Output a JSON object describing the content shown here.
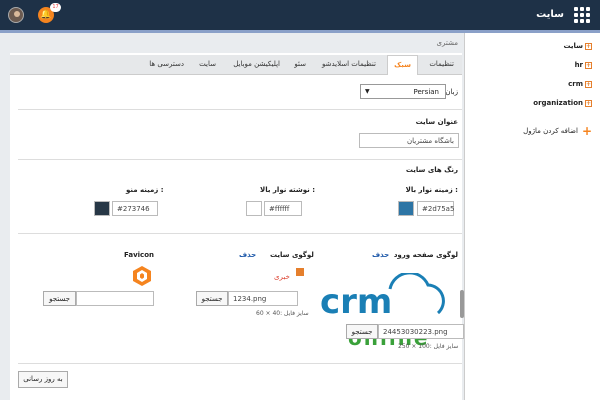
{
  "topbar": {
    "title": "سایت",
    "notification_count": "17",
    "avatar_icon": "user-avatar",
    "bell_icon": "bell-icon",
    "apps_icon": "grid-icon"
  },
  "sidebar": {
    "items": [
      {
        "label": "سایت"
      },
      {
        "label": "hr"
      },
      {
        "label": "crm"
      },
      {
        "label": "organization"
      }
    ],
    "add_module": "اضافه کردن ماژول"
  },
  "breadcrumb": "مشتری",
  "tabs": [
    {
      "label": "تنظیمات"
    },
    {
      "label": "سبک",
      "active": true
    },
    {
      "label": "تنظیمات اسلایدشو"
    },
    {
      "label": "سئو"
    },
    {
      "label": "اپلیکیشن موبایل"
    },
    {
      "label": "سایت"
    },
    {
      "label": "دسترسی ها"
    }
  ],
  "language": {
    "label": "زبان",
    "value": "Persian"
  },
  "site_title": {
    "heading": "عنوان سایت",
    "value": "باشگاه مشتریان"
  },
  "colors": {
    "heading": "رنگ های سایت",
    "topbar_bg": {
      "label": "زمینه نوار بالا :",
      "value": "#2d75a5"
    },
    "topbar_text": {
      "label": "نوشته نوار بالا :",
      "value": "#ffffff"
    },
    "menu_bg": {
      "label": "زمینه منو :",
      "value": "#273746"
    }
  },
  "logos": {
    "login_logo": {
      "label": "لوگوی صفحه ورود",
      "delete": "حذف",
      "file": "24453030223.png",
      "browse": "جستجو",
      "size_hint": "سایز فایل :100 × 250",
      "logo_text_top": "crm",
      "logo_text_bottom": "online"
    },
    "site_logo": {
      "label": "لوگوی سایت",
      "delete": "حذف",
      "file": "1234.png",
      "browse": "جستجو",
      "size_hint": "سایز فایل :40 × 60"
    },
    "favicon": {
      "label": "Favicon",
      "file": "",
      "browse": "جستجو"
    }
  },
  "update_button": "به روز رسانی",
  "theme": {
    "topbar": "#1e3147",
    "accent": "#f5841f",
    "link": "#1a56a8",
    "crm_blue": "#1a7fb5",
    "crm_green": "#3aa13a"
  }
}
